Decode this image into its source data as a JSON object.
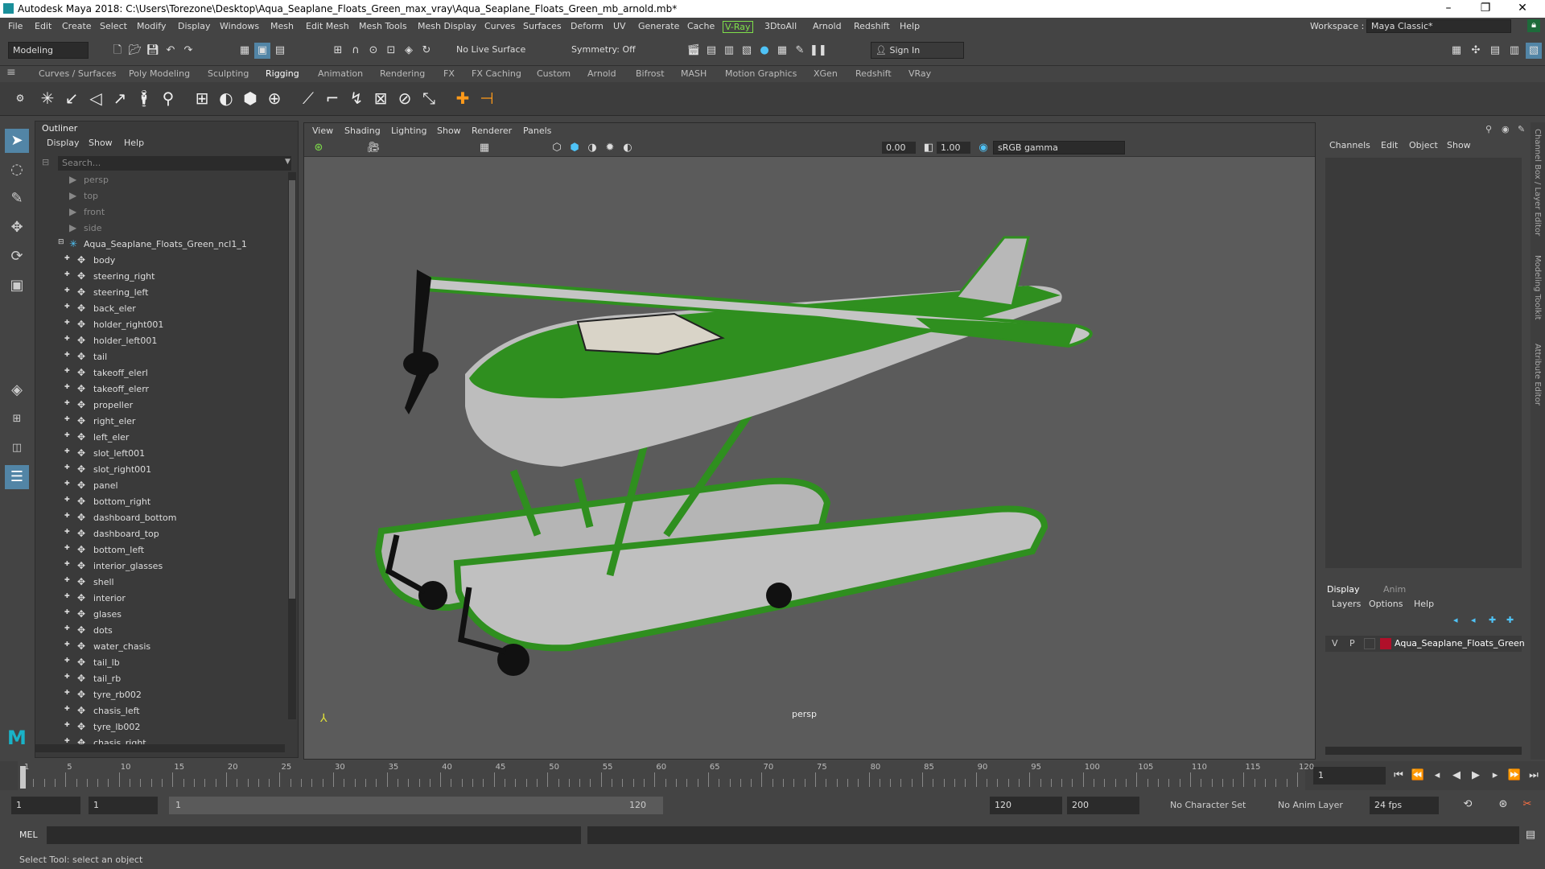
{
  "window": {
    "title": "Autodesk Maya 2018: C:\\Users\\Torezone\\Desktop\\Aqua_Seaplane_Floats_Green_max_vray\\Aqua_Seaplane_Floats_Green_mb_arnold.mb*",
    "minimize": "–",
    "maximize": "❐",
    "close": "✕"
  },
  "menu": [
    "File",
    "Edit",
    "Create",
    "Select",
    "Modify",
    "Display",
    "Windows",
    "Mesh",
    "Edit Mesh",
    "Mesh Tools",
    "Mesh Display",
    "Curves",
    "Surfaces",
    "Deform",
    "UV",
    "Generate",
    "Cache",
    "V-Ray",
    "3DtoAll",
    "Arnold",
    "Redshift",
    "Help"
  ],
  "workspace": {
    "label": "Workspace :",
    "value": "Maya Classic*"
  },
  "status": {
    "mode": "Modeling",
    "live_surface": "No Live Surface",
    "symmetry": "Symmetry: Off",
    "sign_in": "Sign In"
  },
  "shelf_tabs": [
    "Curves / Surfaces",
    "Poly Modeling",
    "Sculpting",
    "Rigging",
    "Animation",
    "Rendering",
    "FX",
    "FX Caching",
    "Custom",
    "Arnold",
    "Bifrost",
    "MASH",
    "Motion Graphics",
    "XGen",
    "Redshift",
    "VRay"
  ],
  "shelf_active": "Rigging",
  "outliner": {
    "title": "Outliner",
    "menu": [
      "Display",
      "Show",
      "Help"
    ],
    "search_placeholder": "Search...",
    "cameras": [
      "persp",
      "top",
      "front",
      "side"
    ],
    "root": "Aqua_Seaplane_Floats_Green_ncl1_1",
    "items": [
      "body",
      "steering_right",
      "steering_left",
      "back_eler",
      "holder_right001",
      "holder_left001",
      "tail",
      "takeoff_elerl",
      "takeoff_elerr",
      "propeller",
      "right_eler",
      "left_eler",
      "slot_left001",
      "slot_right001",
      "panel",
      "bottom_right",
      "dashboard_bottom",
      "dashboard_top",
      "bottom_left",
      "interior_glasses",
      "shell",
      "interior",
      "glases",
      "dots",
      "water_chasis",
      "tail_lb",
      "tail_rb",
      "tyre_rb002",
      "chasis_left",
      "tyre_lb002",
      "chasis_right"
    ]
  },
  "viewport": {
    "menu": [
      "View",
      "Shading",
      "Lighting",
      "Show",
      "Renderer",
      "Panels"
    ],
    "exposure": "0.00",
    "gamma": "1.00",
    "colorspace": "sRGB gamma",
    "camera": "persp"
  },
  "channel_box": {
    "menu": [
      "Channels",
      "Edit",
      "Object",
      "Show"
    ],
    "side_tabs": [
      "Channel Box / Layer Editor",
      "Modeling Toolkit",
      "Attribute Editor"
    ]
  },
  "layers": {
    "tabs": [
      "Display",
      "Anim"
    ],
    "menu": [
      "Layers",
      "Options",
      "Help"
    ],
    "v": "V",
    "p": "P",
    "layer_name": "Aqua_Seaplane_Floats_Green",
    "layer_color": "#b0102a"
  },
  "timeline": {
    "ticks": [
      "1",
      "5",
      "10",
      "15",
      "20",
      "25",
      "30",
      "35",
      "40",
      "45",
      "50",
      "55",
      "60",
      "65",
      "70",
      "75",
      "80",
      "85",
      "90",
      "95",
      "100",
      "105",
      "110",
      "115",
      "120"
    ],
    "current": "1"
  },
  "range": {
    "start": "1",
    "inner_start": "1",
    "slider_start": "1",
    "slider_end": "120",
    "end": "120",
    "anim_end": "200",
    "char_set": "No Character Set",
    "anim_layer": "No Anim Layer",
    "fps": "24 fps"
  },
  "mel": {
    "label": "MEL"
  },
  "help": "Select Tool: select an object",
  "colors": {
    "accent": "#5285a6",
    "plane_green": "#2f8f1f",
    "plane_grey": "#b8b8b8"
  }
}
